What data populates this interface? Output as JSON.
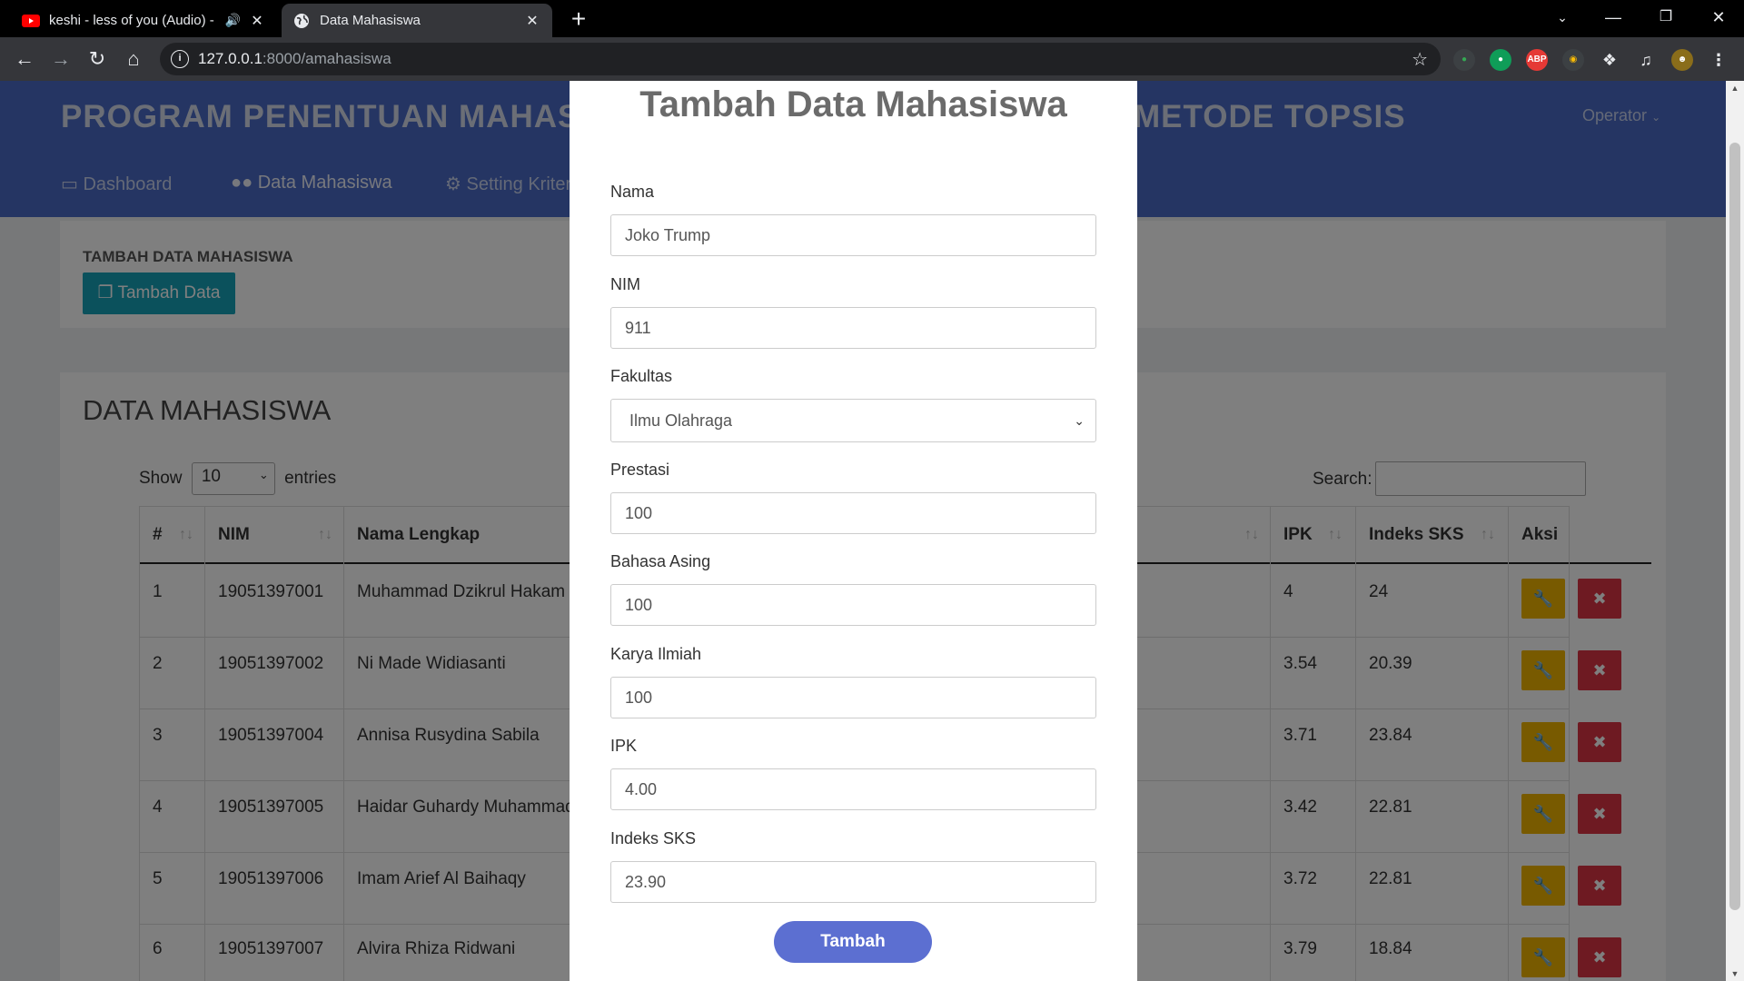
{
  "browser": {
    "tabs": [
      {
        "title": "keshi - less of you (Audio) - YouTube",
        "active": false
      },
      {
        "title": "Data Mahasiswa",
        "active": true
      }
    ],
    "url_host": "127.0.0.1",
    "url_path": ":8000/amahasiswa"
  },
  "app": {
    "brand": "PROGRAM PENENTUAN MAHASISWA BERPRESTASI METODE TOPSIS",
    "brand_left": "PROGRAM PENENTUAN MAHASIS",
    "brand_right": "METODE TOPSIS",
    "user_menu": "Operator",
    "nav": [
      "Dashboard",
      "Data Mahasiswa",
      "Setting Kriteria"
    ],
    "add_section_title": "TAMBAH DATA MAHASISWA",
    "add_button": "Tambah Data",
    "list_title": "DATA MAHASISWA",
    "show_label": "Show",
    "entries_value": "10",
    "entries_label": "entries",
    "search_label": "Search:",
    "columns": [
      "#",
      "NIM",
      "Nama Lengkap",
      "IPK",
      "Indeks SKS",
      "Aksi"
    ],
    "rows": [
      {
        "no": "1",
        "nim": "19051397001",
        "nama": "Muhammad Dzikrul Hakam",
        "ipk": "4",
        "sks": "24"
      },
      {
        "no": "2",
        "nim": "19051397002",
        "nama": "Ni Made Widiasanti",
        "ipk": "3.54",
        "sks": "20.39"
      },
      {
        "no": "3",
        "nim": "19051397004",
        "nama": "Annisa Rusydina Sabila",
        "ipk": "3.71",
        "sks": "23.84"
      },
      {
        "no": "4",
        "nim": "19051397005",
        "nama": "Haidar Guhardy Muhammad",
        "ipk": "3.42",
        "sks": "22.81"
      },
      {
        "no": "5",
        "nim": "19051397006",
        "nama": "Imam Arief Al Baihaqy",
        "ipk": "3.72",
        "sks": "22.81"
      },
      {
        "no": "6",
        "nim": "19051397007",
        "nama": "Alvira Rhiza Ridwani",
        "ipk": "3.79",
        "sks": "18.84"
      }
    ]
  },
  "modal": {
    "title": "Tambah Data Mahasiswa",
    "fields": [
      {
        "label": "Nama",
        "value": "Joko Trump"
      },
      {
        "label": "NIM",
        "value": "911"
      },
      {
        "label": "Fakultas",
        "value": "Ilmu Olahraga"
      },
      {
        "label": "Prestasi",
        "value": "100"
      },
      {
        "label": "Bahasa Asing",
        "value": "100"
      },
      {
        "label": "Karya Ilmiah",
        "value": "100"
      },
      {
        "label": "IPK",
        "value": "4.00"
      },
      {
        "label": "Indeks SKS",
        "value": "23.90"
      }
    ],
    "submit": "Tambah"
  },
  "colors": {
    "header": "#4a6bc7",
    "add_button": "#17a2b8",
    "edit_button": "#f0b400",
    "delete_button": "#dc3545",
    "submit_button": "#5c6fd1"
  }
}
